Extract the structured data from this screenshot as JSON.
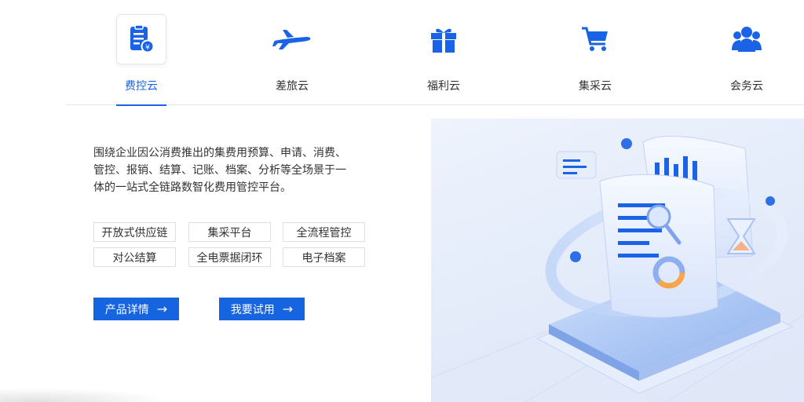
{
  "tabs": [
    {
      "label": "费控云",
      "icon": "expense-doc-icon",
      "active": true
    },
    {
      "label": "差旅云",
      "icon": "airplane-icon",
      "active": false
    },
    {
      "label": "福利云",
      "icon": "gift-icon",
      "active": false
    },
    {
      "label": "集采云",
      "icon": "shopping-cart-icon",
      "active": false
    },
    {
      "label": "会务云",
      "icon": "group-icon",
      "active": false
    }
  ],
  "content": {
    "description": "围绕企业因公消费推出的集费用预算、申请、消费、管控、报销、结算、记账、档案、分析等全场景于一体的一站式全链路数智化费用管控平台。",
    "features": [
      "开放式供应链",
      "集采平台",
      "全流程管控",
      "对公结算",
      "全电票据闭环",
      "电子档案"
    ],
    "buttons": {
      "details": "产品详情",
      "trial": "我要试用",
      "arrow": "→"
    }
  },
  "colors": {
    "accent": "#1a63e6",
    "button": "#1664e0",
    "text": "#333333",
    "border": "#dcdfe5"
  }
}
